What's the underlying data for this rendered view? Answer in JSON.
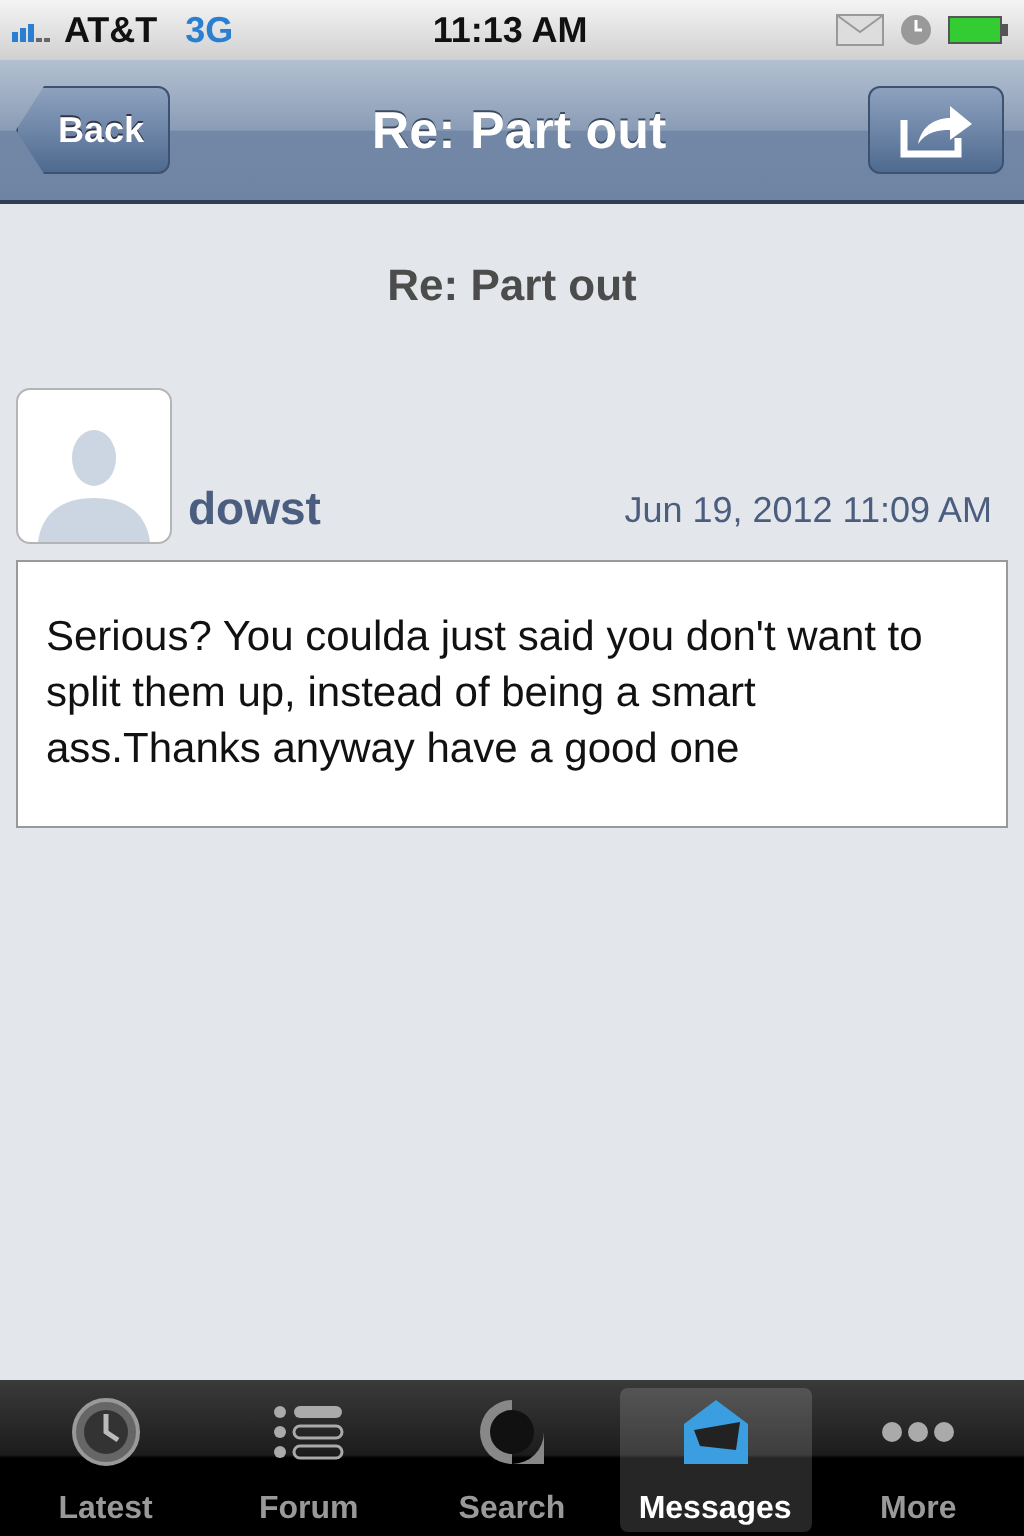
{
  "status_bar": {
    "carrier": "AT&T",
    "network": "3G",
    "time": "11:13 AM"
  },
  "nav_bar": {
    "back": "Back",
    "title": "Re: Part out"
  },
  "thread_title": "Re: Part out",
  "posts": [
    {
      "author": "dowst",
      "date": "Jun 19, 2012 11:09 AM",
      "body": "Serious? You coulda just said you don't want to split them up, instead of being a smart ass.Thanks anyway have a good one"
    }
  ],
  "tabs": [
    {
      "label": "Latest",
      "kind": "clock",
      "selected": false
    },
    {
      "label": "Forum",
      "kind": "list",
      "selected": false
    },
    {
      "label": "Search",
      "kind": "search",
      "selected": false
    },
    {
      "label": "Messages",
      "kind": "envelope",
      "selected": true
    },
    {
      "label": "More",
      "kind": "dots",
      "selected": false
    }
  ]
}
